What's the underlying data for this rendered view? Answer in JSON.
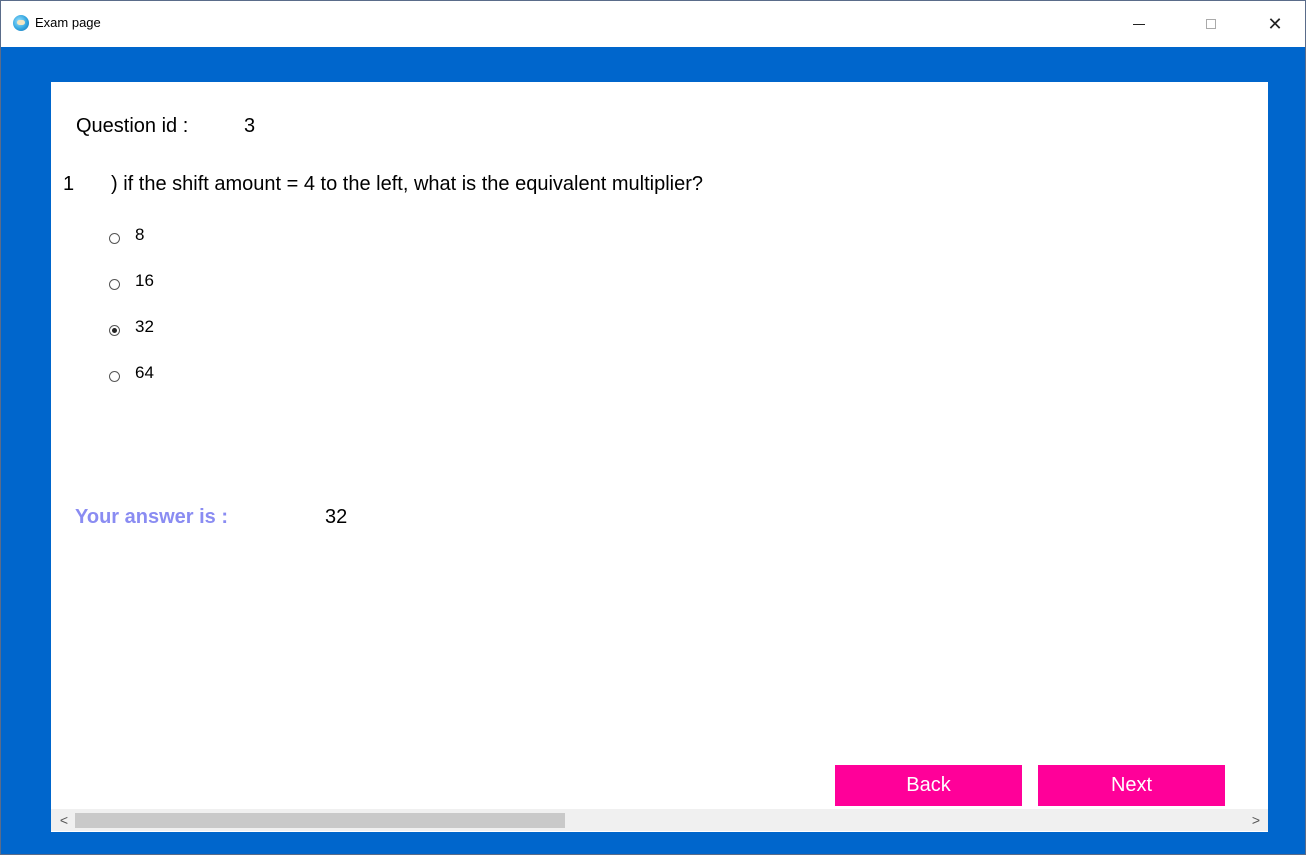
{
  "window": {
    "title": "Exam page",
    "app_icon": "app-icon",
    "controls": {
      "minimize": "minimize-icon",
      "maximize": "maximize-icon",
      "close": "close-icon",
      "close_glyph": "✕"
    }
  },
  "question": {
    "id_label": "Question id :",
    "id_value": "3",
    "number": "1",
    "text": ") if the shift amount = 4 to the left, what is the equivalent multiplier?",
    "options": [
      {
        "label": "8",
        "selected": false
      },
      {
        "label": "16",
        "selected": false
      },
      {
        "label": "32",
        "selected": true
      },
      {
        "label": "64",
        "selected": false
      }
    ]
  },
  "answer": {
    "label": "Your answer is :",
    "value": "32"
  },
  "buttons": {
    "back": "Back",
    "next": "Next"
  },
  "scrollbar": {
    "left_arrow": "<",
    "right_arrow": ">"
  },
  "colors": {
    "window_background": "#0066cc",
    "button": "#ff0099",
    "answer_label": "#8a8cf2"
  }
}
